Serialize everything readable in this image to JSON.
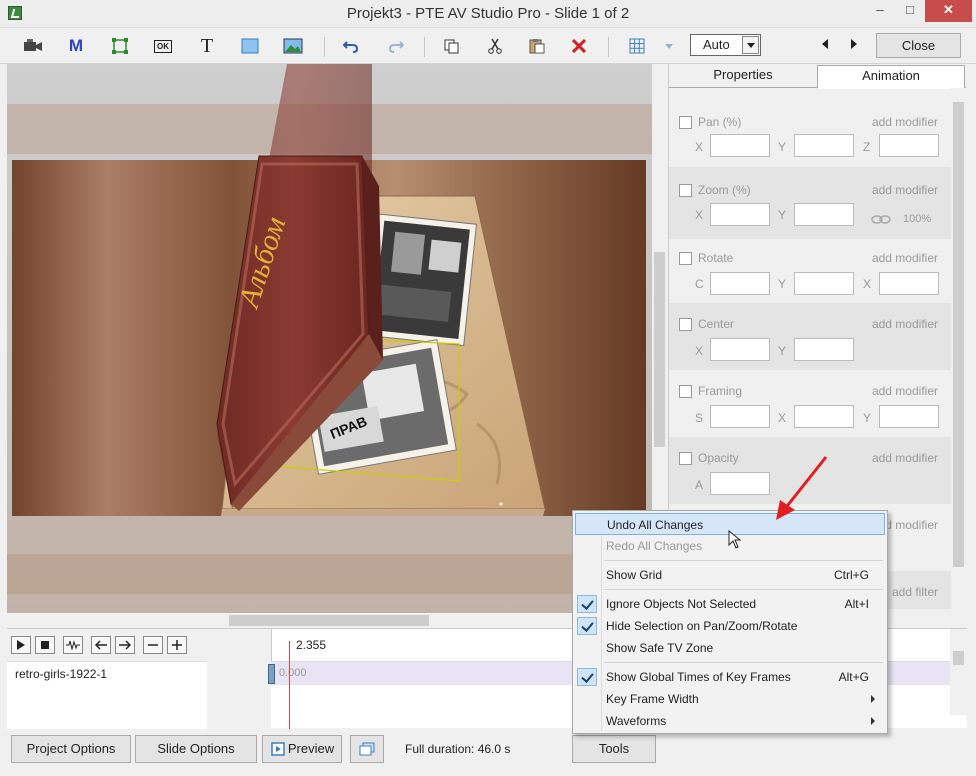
{
  "window": {
    "title": "Projekt3 - PTE AV Studio Pro - Slide 1 of 2",
    "minimize": "‒",
    "maximize": "□",
    "close": "✕"
  },
  "toolbar": {
    "icons": [
      "camera-icon",
      "mask-icon",
      "frame-icon",
      "button-object-icon",
      "text-icon",
      "rectangle-icon",
      "image-icon",
      "undo-icon",
      "redo-icon",
      "copy-icon",
      "cut-icon",
      "paste-icon",
      "delete-icon",
      "grid-icon"
    ],
    "mask_letter": "M",
    "button_letters": "OK",
    "text_letter": "T",
    "zoom_value": "Auto",
    "close_label": "Close"
  },
  "stage": {
    "album_title": "Альбом",
    "newspaper_text": "ПРАВ"
  },
  "panel": {
    "tabs": [
      "Properties",
      "Animation"
    ],
    "active_tab": "Animation",
    "add_modifier": "add modifier",
    "add_filter": "add filter",
    "params": [
      {
        "name": "Pan (%)",
        "fields": [
          "X",
          "Y",
          "Z"
        ]
      },
      {
        "name": "Zoom (%)",
        "fields": [
          "X",
          "Y"
        ],
        "zoom_value": "100%"
      },
      {
        "name": "Rotate",
        "fields": [
          "C",
          "Y",
          "X"
        ]
      },
      {
        "name": "Center",
        "fields": [
          "X",
          "Y"
        ]
      },
      {
        "name": "Framing",
        "fields": [
          "S",
          "X",
          "Y"
        ]
      },
      {
        "name": "Opacity",
        "fields": [
          "A"
        ]
      }
    ]
  },
  "timeline": {
    "time_label": "2.355",
    "track_name": "retro-girls-1922-1",
    "key_time": "0.000"
  },
  "bottom": {
    "project_options": "Project Options",
    "slide_options": "Slide Options",
    "preview": "Preview",
    "duration": "Full duration: 46.0 s",
    "tools": "Tools"
  },
  "context_menu": {
    "items": [
      {
        "label": "Undo All Changes",
        "shortcut": "",
        "checked": false,
        "enabled": true,
        "highlighted": true
      },
      {
        "label": "Redo All Changes",
        "shortcut": "",
        "checked": false,
        "enabled": false
      },
      {
        "label": "Show Grid",
        "shortcut": "Ctrl+G",
        "checked": false,
        "enabled": true
      },
      {
        "label": "Ignore Objects Not Selected",
        "shortcut": "Alt+I",
        "checked": true,
        "enabled": true
      },
      {
        "label": "Hide Selection on Pan/Zoom/Rotate",
        "shortcut": "",
        "checked": true,
        "enabled": true
      },
      {
        "label": "Show Safe TV Zone",
        "shortcut": "",
        "checked": false,
        "enabled": true
      },
      {
        "label": "Show Global Times of Key Frames",
        "shortcut": "Alt+G",
        "checked": true,
        "enabled": true
      },
      {
        "label": "Key Frame Width",
        "shortcut": "",
        "checked": false,
        "enabled": true,
        "submenu": true
      },
      {
        "label": "Waveforms",
        "shortcut": "",
        "checked": false,
        "enabled": true,
        "submenu": true
      }
    ]
  },
  "colors": {
    "accent": "#cfe4f7",
    "close_red": "#c74d4d",
    "annotation_arrow": "#e02020"
  }
}
